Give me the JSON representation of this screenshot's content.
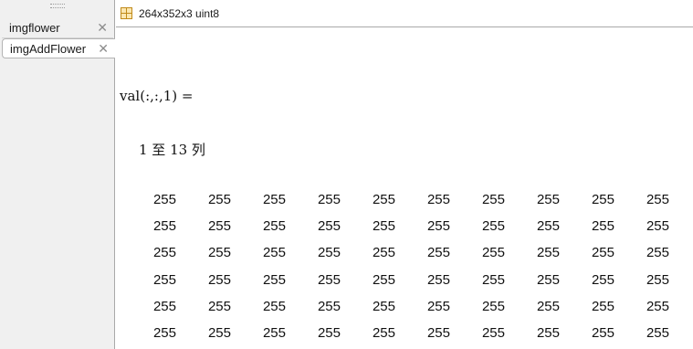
{
  "tabs": [
    {
      "label": "imgflower",
      "close": "✕"
    },
    {
      "label": "imgAddFlower",
      "close": "✕"
    }
  ],
  "header": {
    "info": "264x352x3 uint8"
  },
  "output": {
    "val_line": "val(:,:,1) =",
    "cols_line": "1 至 13 列",
    "rows": [
      [
        "255",
        "255",
        "255",
        "255",
        "255",
        "255",
        "255",
        "255",
        "255",
        "255"
      ],
      [
        "255",
        "255",
        "255",
        "255",
        "255",
        "255",
        "255",
        "255",
        "255",
        "255"
      ],
      [
        "255",
        "255",
        "255",
        "255",
        "255",
        "255",
        "255",
        "255",
        "255",
        "255"
      ],
      [
        "255",
        "255",
        "255",
        "255",
        "255",
        "255",
        "255",
        "255",
        "255",
        "255"
      ],
      [
        "255",
        "255",
        "255",
        "255",
        "255",
        "255",
        "255",
        "255",
        "255",
        "255"
      ],
      [
        "255",
        "255",
        "255",
        "255",
        "255",
        "255",
        "255",
        "255",
        "255",
        "255"
      ]
    ]
  },
  "colors": {
    "icon_border": "#c08a1a",
    "icon_fill": "#fbe7b1",
    "panel_bg": "#f0f0f0"
  }
}
